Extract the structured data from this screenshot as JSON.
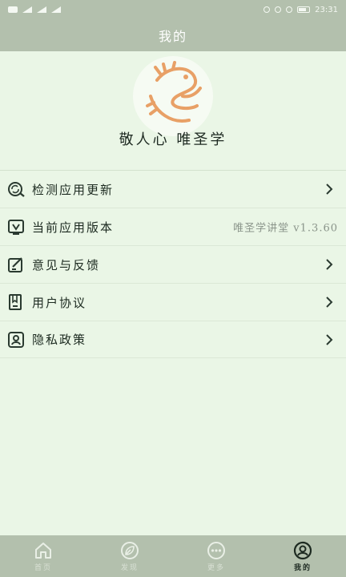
{
  "status_bar": {
    "time": "23:31"
  },
  "header": {
    "title": "我的"
  },
  "profile": {
    "motto": "敬人心 唯圣学",
    "avatar_icon": "dragon-logo-icon"
  },
  "menu": {
    "items": [
      {
        "label": "检测应用更新",
        "icon": "update-check-icon"
      },
      {
        "label": "当前应用版本",
        "icon": "version-icon",
        "value": "唯圣学讲堂 v1.3.60"
      },
      {
        "label": "意见与反馈",
        "icon": "feedback-icon"
      },
      {
        "label": "用户协议",
        "icon": "agreement-icon"
      },
      {
        "label": "隐私政策",
        "icon": "privacy-icon"
      }
    ]
  },
  "tab_bar": {
    "tabs": [
      {
        "label": "首页",
        "icon": "home-icon"
      },
      {
        "label": "发现",
        "icon": "leaf-icon"
      },
      {
        "label": "更多",
        "icon": "more-icon"
      },
      {
        "label": "我的",
        "icon": "profile-icon",
        "active": true
      }
    ]
  },
  "colors": {
    "bar": "#b3c0ad",
    "background": "#eaf6e6",
    "accent": "#e8a066"
  }
}
